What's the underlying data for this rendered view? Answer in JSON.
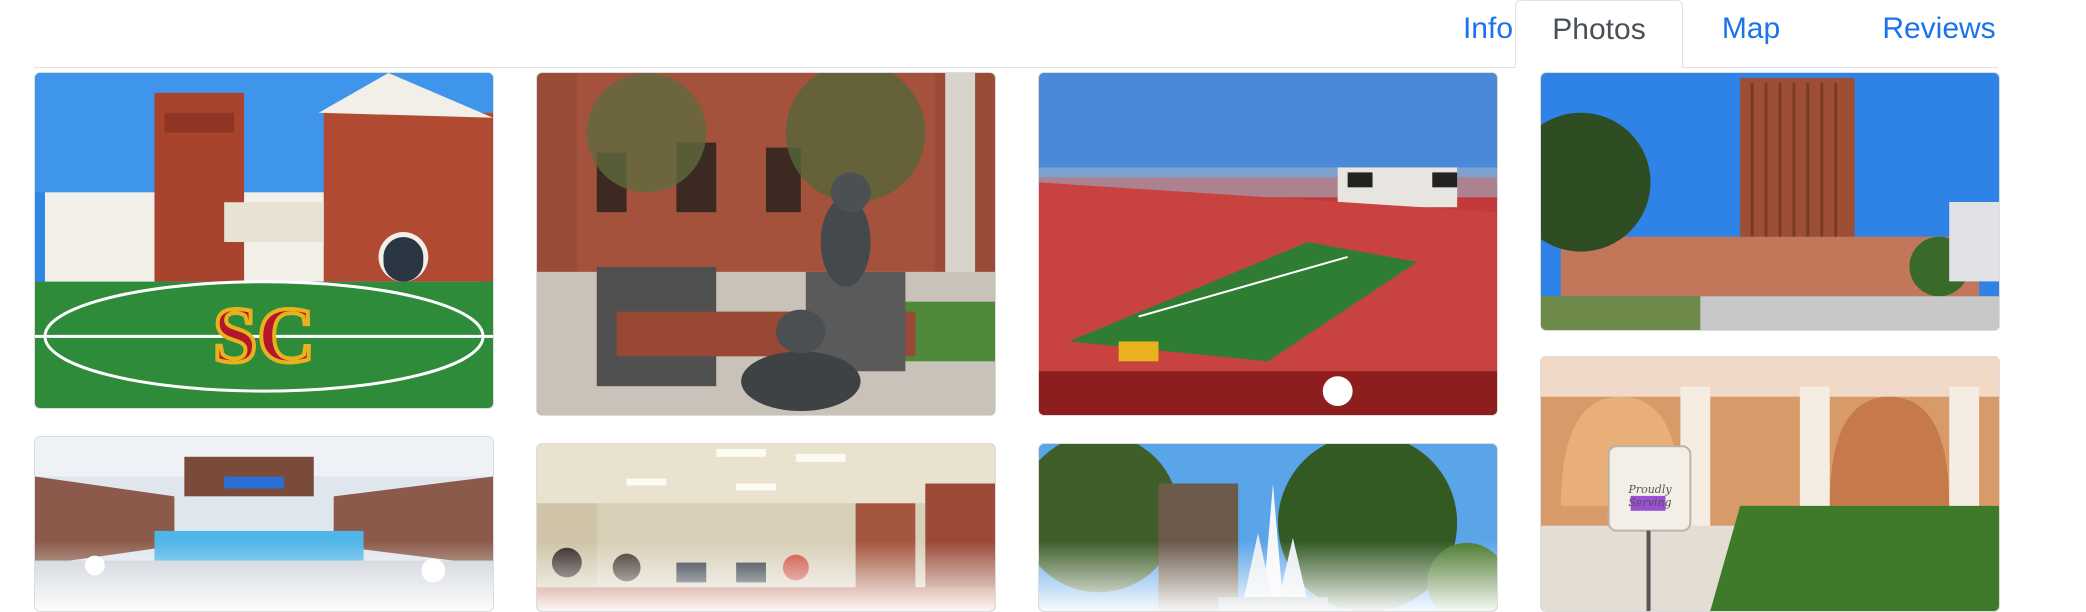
{
  "tabs": [
    {
      "label": "Info",
      "active": false
    },
    {
      "label": "Photos",
      "active": true
    },
    {
      "label": "Map",
      "active": false
    },
    {
      "label": "Reviews",
      "active": false
    }
  ],
  "photos": [
    {
      "subject": "stadium-field-building"
    },
    {
      "subject": "dog-statue-bench"
    },
    {
      "subject": "football-stadium-crowd"
    },
    {
      "subject": "brick-tower"
    },
    {
      "subject": "swimming-stadium"
    },
    {
      "subject": "library-study-room"
    },
    {
      "subject": "fountain-trees"
    },
    {
      "subject": "arcade-courtyard-sign"
    }
  ],
  "sign": {
    "text": "Proudly Serving"
  },
  "colors": {
    "link": "#1a73e8",
    "active_tab_text": "#495057",
    "border": "#dee2e6",
    "brick": "#a8432e",
    "field_green": "#2e8b3a",
    "sky": "#3d8fe0",
    "cardinal": "#b3162b",
    "gold": "#e8b21f"
  }
}
